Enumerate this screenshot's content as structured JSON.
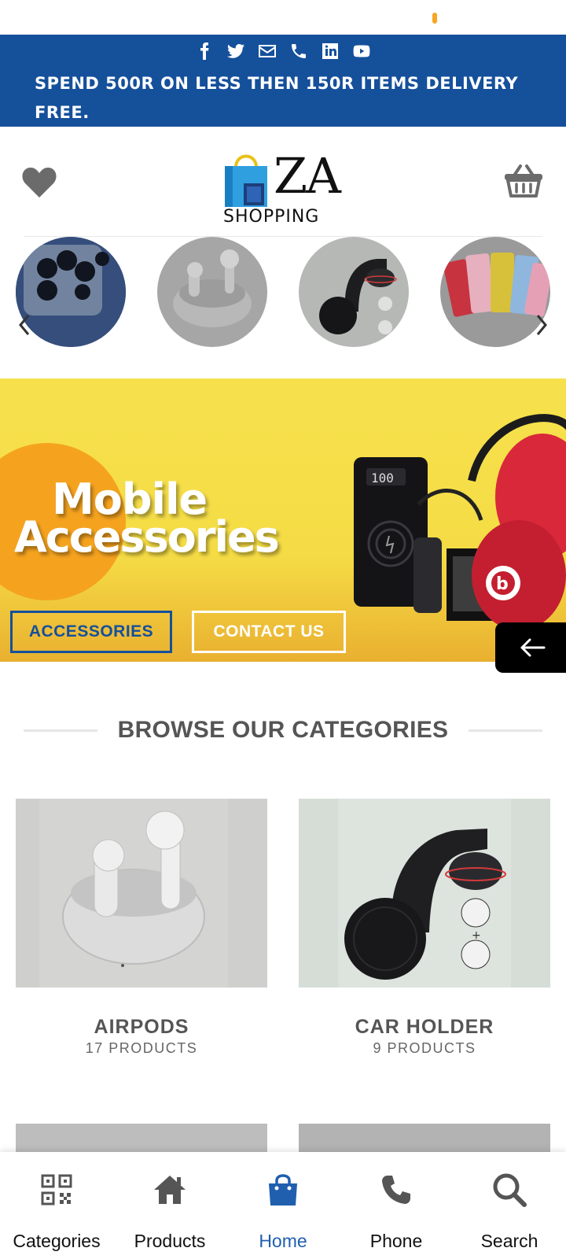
{
  "topbar": {
    "social_icons": [
      "facebook-icon",
      "twitter-icon",
      "envelope-icon",
      "phone-icon",
      "linkedin-icon",
      "youtube-icon"
    ],
    "promo": "SPEND 500R ON LESS THEN 150R ITEMS DELIVERY FREE.",
    "color": "#15509b"
  },
  "header": {
    "logo_text": "ZA",
    "logo_subtext": "SHOPPING",
    "wishlist_icon": "heart-icon",
    "cart_icon": "basket-icon"
  },
  "carousel": {
    "items": [
      "camera-lens-protector",
      "wireless-earbuds",
      "car-phone-holder",
      "phone-cases"
    ],
    "prev_icon": "chevron-left-icon",
    "next_icon": "chevron-right-icon"
  },
  "banner": {
    "title_line1": "Mobile",
    "title_line2": "Accessories",
    "buttons": {
      "accessories": "ACCESSORIES",
      "contact": "CONTACT US"
    }
  },
  "categories": {
    "heading": "BROWSE OUR CATEGORIES",
    "items": [
      {
        "name": "AIRPODS",
        "count": "17 PRODUCTS"
      },
      {
        "name": "CAR HOLDER",
        "count": "9 PRODUCTS"
      }
    ]
  },
  "bottom_nav": {
    "items": [
      {
        "label": "Categories",
        "icon": "qr-code-icon"
      },
      {
        "label": "Products",
        "icon": "home-icon"
      },
      {
        "label": "Home",
        "icon": "shopping-bag-icon",
        "active": true
      },
      {
        "label": "Phone",
        "icon": "phone-icon"
      },
      {
        "label": "Search",
        "icon": "search-icon"
      }
    ],
    "active_color": "#1f5fae"
  }
}
